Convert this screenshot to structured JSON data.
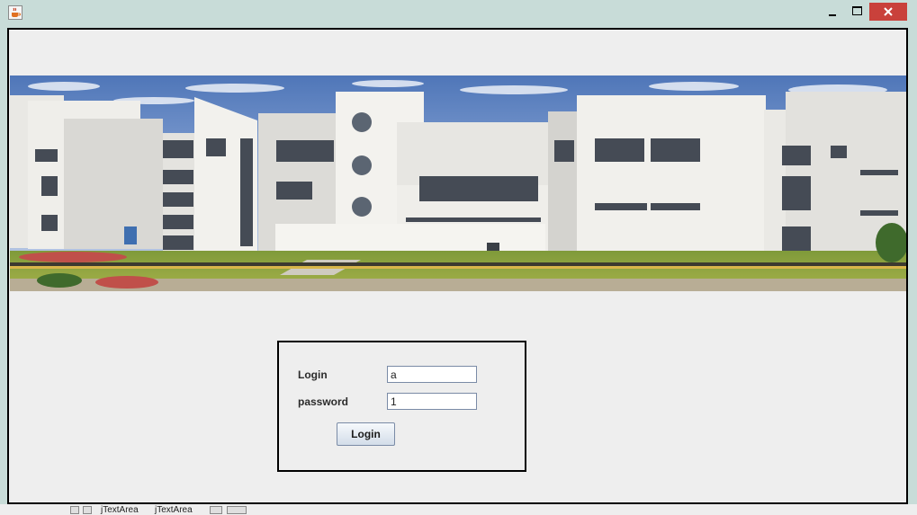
{
  "window": {
    "icon": "java-cup-icon",
    "controls": [
      "minimize-icon",
      "maximize-icon",
      "close-icon"
    ],
    "close_color": "#c9413b"
  },
  "banner": {
    "image": "campus-building-photo"
  },
  "login_form": {
    "login_label": "Login",
    "login_value": "a",
    "password_label": "password",
    "password_value": "1",
    "submit_label": "Login"
  },
  "taskbar": {
    "tabs": [
      "jTextArea",
      "jTextArea"
    ]
  }
}
